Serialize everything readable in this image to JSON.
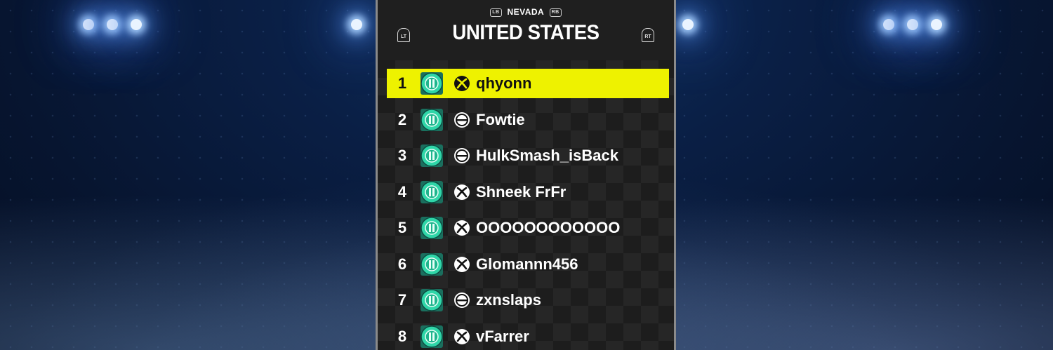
{
  "header": {
    "left_bumper": "LB",
    "region": "NEVADA",
    "right_bumper": "RB",
    "title": "UNITED STATES",
    "left_trigger": "LT",
    "right_trigger": "RT"
  },
  "leaderboard": {
    "rows": [
      {
        "rank": "1",
        "name": "qhyonn",
        "platform": "xbox",
        "highlighted": true
      },
      {
        "rank": "2",
        "name": "Fowtie",
        "platform": "epic",
        "highlighted": false
      },
      {
        "rank": "3",
        "name": "HulkSmash_isBack",
        "platform": "epic",
        "highlighted": false
      },
      {
        "rank": "4",
        "name": "Shneek FrFr",
        "platform": "xbox",
        "highlighted": false
      },
      {
        "rank": "5",
        "name": "OOOOOOOOOOOO",
        "platform": "xbox",
        "highlighted": false
      },
      {
        "rank": "6",
        "name": "Glomannn456",
        "platform": "xbox",
        "highlighted": false
      },
      {
        "rank": "7",
        "name": "zxnslaps",
        "platform": "epic",
        "highlighted": false
      },
      {
        "rank": "8",
        "name": "vFarrer",
        "platform": "xbox",
        "highlighted": false
      }
    ]
  },
  "colors": {
    "highlight": "#eef200",
    "badge": "#2fd6a8",
    "panel_border": "#8a8a8a"
  },
  "icons": {
    "badge": "rank-badge-icon",
    "xbox": "xbox-icon",
    "epic": "epic-games-icon"
  }
}
